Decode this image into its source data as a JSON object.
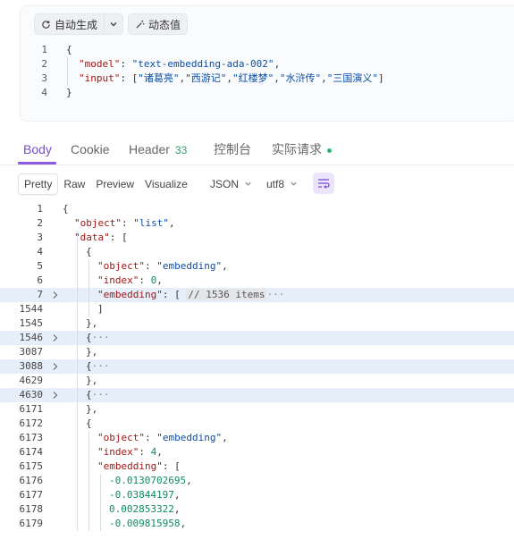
{
  "request": {
    "auto_generate_label": "自动生成",
    "dynamic_value_label": "动态值",
    "lines": [
      {
        "num": "1",
        "indent": 0,
        "parts": [
          {
            "c": "p",
            "t": "{"
          }
        ]
      },
      {
        "num": "2",
        "indent": 1,
        "parts": [
          {
            "c": "k",
            "t": "\"model\""
          },
          {
            "c": "p",
            "t": ": "
          },
          {
            "c": "s",
            "t": "\"text-embedding-ada-002\""
          },
          {
            "c": "p",
            "t": ","
          }
        ]
      },
      {
        "num": "3",
        "indent": 1,
        "parts": [
          {
            "c": "k",
            "t": "\"input\""
          },
          {
            "c": "p",
            "t": ": ["
          },
          {
            "c": "s",
            "t": "\"诸葛亮\""
          },
          {
            "c": "p",
            "t": ","
          },
          {
            "c": "s",
            "t": "\"西游记\""
          },
          {
            "c": "p",
            "t": ","
          },
          {
            "c": "s",
            "t": "\"红楼梦\""
          },
          {
            "c": "p",
            "t": ","
          },
          {
            "c": "s",
            "t": "\"水浒传\""
          },
          {
            "c": "p",
            "t": ","
          },
          {
            "c": "s",
            "t": "\"三国演义\""
          },
          {
            "c": "p",
            "t": "]"
          }
        ]
      },
      {
        "num": "4",
        "indent": 0,
        "parts": [
          {
            "c": "p",
            "t": "}"
          }
        ]
      }
    ]
  },
  "tabs": {
    "body": "Body",
    "cookie": "Cookie",
    "header": "Header",
    "header_count": "33",
    "console": "控制台",
    "actual_request": "实际请求"
  },
  "toolbar": {
    "pretty": "Pretty",
    "raw": "Raw",
    "preview": "Preview",
    "visualize": "Visualize",
    "format": "JSON",
    "encoding": "utf8"
  },
  "response": {
    "lines": [
      {
        "num": "1",
        "indent": 0,
        "fold": false,
        "hl": false,
        "parts": [
          {
            "c": "p",
            "t": "{"
          }
        ]
      },
      {
        "num": "2",
        "indent": 1,
        "fold": false,
        "hl": false,
        "parts": [
          {
            "c": "k",
            "t": "\"object\""
          },
          {
            "c": "p",
            "t": ": "
          },
          {
            "c": "s",
            "t": "\"list\""
          },
          {
            "c": "p",
            "t": ","
          }
        ]
      },
      {
        "num": "3",
        "indent": 1,
        "fold": false,
        "hl": false,
        "parts": [
          {
            "c": "k",
            "t": "\"data\""
          },
          {
            "c": "p",
            "t": ": ["
          }
        ]
      },
      {
        "num": "4",
        "indent": 2,
        "fold": false,
        "hl": false,
        "parts": [
          {
            "c": "p",
            "t": "{"
          }
        ]
      },
      {
        "num": "5",
        "indent": 3,
        "fold": false,
        "hl": false,
        "parts": [
          {
            "c": "k",
            "t": "\"object\""
          },
          {
            "c": "p",
            "t": ": "
          },
          {
            "c": "s",
            "t": "\"embedding\""
          },
          {
            "c": "p",
            "t": ","
          }
        ]
      },
      {
        "num": "6",
        "indent": 3,
        "fold": false,
        "hl": false,
        "parts": [
          {
            "c": "k",
            "t": "\"index\""
          },
          {
            "c": "p",
            "t": ": "
          },
          {
            "c": "n",
            "t": "0"
          },
          {
            "c": "p",
            "t": ","
          }
        ]
      },
      {
        "num": "7",
        "indent": 3,
        "fold": true,
        "hl": true,
        "parts": [
          {
            "c": "k",
            "t": "\"embedding\""
          },
          {
            "c": "p",
            "t": ": [ "
          },
          {
            "c": "badge",
            "t": "// 1536 items"
          },
          {
            "c": "fold-mark",
            "t": "···"
          }
        ]
      },
      {
        "num": "1544",
        "indent": 3,
        "fold": false,
        "hl": false,
        "parts": [
          {
            "c": "p",
            "t": "]"
          }
        ]
      },
      {
        "num": "1545",
        "indent": 2,
        "fold": false,
        "hl": false,
        "parts": [
          {
            "c": "p",
            "t": "},"
          }
        ]
      },
      {
        "num": "1546",
        "indent": 2,
        "fold": true,
        "hl": true,
        "parts": [
          {
            "c": "p",
            "t": "{"
          },
          {
            "c": "fold-mark",
            "t": "···"
          }
        ]
      },
      {
        "num": "3087",
        "indent": 2,
        "fold": false,
        "hl": false,
        "parts": [
          {
            "c": "p",
            "t": "},"
          }
        ]
      },
      {
        "num": "3088",
        "indent": 2,
        "fold": true,
        "hl": true,
        "parts": [
          {
            "c": "p",
            "t": "{"
          },
          {
            "c": "fold-mark",
            "t": "···"
          }
        ]
      },
      {
        "num": "4629",
        "indent": 2,
        "fold": false,
        "hl": false,
        "parts": [
          {
            "c": "p",
            "t": "},"
          }
        ]
      },
      {
        "num": "4630",
        "indent": 2,
        "fold": true,
        "hl": true,
        "parts": [
          {
            "c": "p",
            "t": "{"
          },
          {
            "c": "fold-mark",
            "t": "···"
          }
        ]
      },
      {
        "num": "6171",
        "indent": 2,
        "fold": false,
        "hl": false,
        "parts": [
          {
            "c": "p",
            "t": "},"
          }
        ]
      },
      {
        "num": "6172",
        "indent": 2,
        "fold": false,
        "hl": false,
        "parts": [
          {
            "c": "p",
            "t": "{"
          }
        ]
      },
      {
        "num": "6173",
        "indent": 3,
        "fold": false,
        "hl": false,
        "parts": [
          {
            "c": "k",
            "t": "\"object\""
          },
          {
            "c": "p",
            "t": ": "
          },
          {
            "c": "s",
            "t": "\"embedding\""
          },
          {
            "c": "p",
            "t": ","
          }
        ]
      },
      {
        "num": "6174",
        "indent": 3,
        "fold": false,
        "hl": false,
        "parts": [
          {
            "c": "k",
            "t": "\"index\""
          },
          {
            "c": "p",
            "t": ": "
          },
          {
            "c": "n",
            "t": "4"
          },
          {
            "c": "p",
            "t": ","
          }
        ]
      },
      {
        "num": "6175",
        "indent": 3,
        "fold": false,
        "hl": false,
        "parts": [
          {
            "c": "k",
            "t": "\"embedding\""
          },
          {
            "c": "p",
            "t": ": ["
          }
        ]
      },
      {
        "num": "6176",
        "indent": 4,
        "fold": false,
        "hl": false,
        "parts": [
          {
            "c": "n",
            "t": "-0.0130702695"
          },
          {
            "c": "p",
            "t": ","
          }
        ]
      },
      {
        "num": "6177",
        "indent": 4,
        "fold": false,
        "hl": false,
        "parts": [
          {
            "c": "n",
            "t": "-0.03844197"
          },
          {
            "c": "p",
            "t": ","
          }
        ]
      },
      {
        "num": "6178",
        "indent": 4,
        "fold": false,
        "hl": false,
        "parts": [
          {
            "c": "n",
            "t": "0.002853322"
          },
          {
            "c": "p",
            "t": ","
          }
        ]
      },
      {
        "num": "6179",
        "indent": 4,
        "fold": false,
        "hl": false,
        "parts": [
          {
            "c": "n",
            "t": "-0.009815958"
          },
          {
            "c": "p",
            "t": ","
          }
        ]
      }
    ]
  },
  "colors": {
    "accent": "#7a4bd1",
    "key": "#a31515",
    "string": "#0a4ea8",
    "number": "#0f8a5f",
    "highlight": "#e6eef9",
    "success": "#2bb673"
  }
}
